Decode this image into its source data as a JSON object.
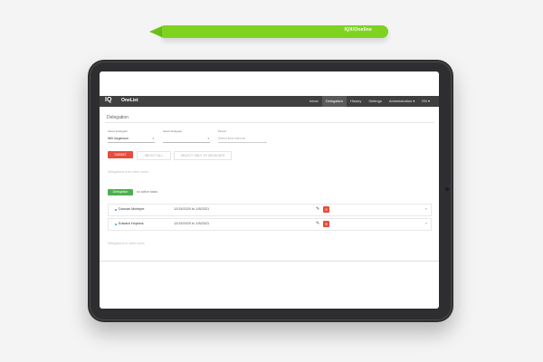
{
  "pencil": {
    "brand": "IQX/Oneline"
  },
  "app": {
    "logo": "IQ",
    "title": "OneList"
  },
  "nav": {
    "items": [
      {
        "label": "Inbox",
        "active": false
      },
      {
        "label": "Delegation",
        "active": true
      },
      {
        "label": "History",
        "active": false
      },
      {
        "label": "Settings",
        "active": false
      },
      {
        "label": "Administration ▾",
        "active": false
      },
      {
        "label": "EN ▾",
        "active": false
      }
    ]
  },
  "page": {
    "title": "Delegation"
  },
  "form": {
    "delegator_label": "Select Delegator",
    "delegator_value": "Will Jorgenson",
    "delegate_label": "Select Delegate",
    "delegate_value": "",
    "period_label": "Period",
    "period_placeholder": "Select time interval"
  },
  "actions": {
    "submit": "SUBMIT",
    "select_all": "SELECT ALL",
    "select_only_to_delegate": "SELECT ONLY TO DELEGATE"
  },
  "sections": {
    "from_me": "Delegations from other users",
    "to_me": "Delegations to other users"
  },
  "tabs": {
    "delegation": "Delegation",
    "no_active": "no active tasks"
  },
  "rows": [
    {
      "name": "Duncan Mcintyre",
      "period": "12/15/2020 to 1/8/2021"
    },
    {
      "name": "Edward Hopkins",
      "period": "12/15/2020 to 1/8/2021"
    }
  ]
}
